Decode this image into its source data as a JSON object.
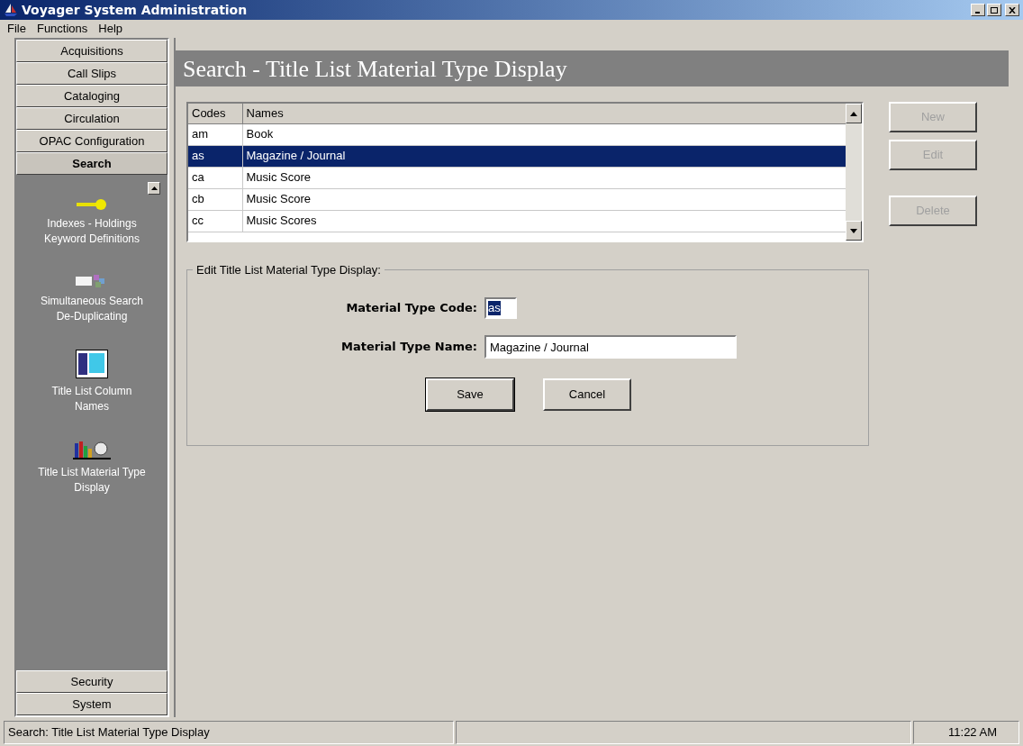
{
  "window": {
    "title": "Voyager System Administration"
  },
  "menu": [
    "File",
    "Functions",
    "Help"
  ],
  "sidebar": {
    "sections_top": [
      {
        "label": "Acquisitions",
        "expanded": false
      },
      {
        "label": "Call Slips",
        "expanded": false
      },
      {
        "label": "Cataloging",
        "expanded": false
      },
      {
        "label": "Circulation",
        "expanded": false
      },
      {
        "label": "OPAC Configuration",
        "expanded": false
      },
      {
        "label": "Search",
        "expanded": true
      }
    ],
    "items": [
      {
        "kind": "key",
        "label": "Indexes - Holdings Keyword Definitions"
      },
      {
        "kind": "dedup",
        "label": "Simultaneous Search De-Duplicating"
      },
      {
        "kind": "columns",
        "label": "Title List Column Names"
      },
      {
        "kind": "material",
        "label": "Title List Material Type Display"
      }
    ],
    "sections_bottom": [
      {
        "label": "Security",
        "expanded": false
      },
      {
        "label": "System",
        "expanded": false
      }
    ]
  },
  "header": "Search - Title List Material Type Display",
  "table": {
    "columns": [
      "Codes",
      "Names"
    ],
    "rows": [
      {
        "code": "am",
        "name": "Book",
        "selected": false
      },
      {
        "code": "as",
        "name": "Magazine / Journal",
        "selected": true
      },
      {
        "code": "ca",
        "name": "Music Score",
        "selected": false
      },
      {
        "code": "cb",
        "name": "Music Score",
        "selected": false
      },
      {
        "code": "cc",
        "name": "Music Scores",
        "selected": false
      }
    ]
  },
  "side_buttons": [
    {
      "label": "New",
      "disabled": true
    },
    {
      "label": "Edit",
      "disabled": true
    },
    {
      "label": "Delete",
      "disabled": true
    }
  ],
  "edit_group": {
    "title": "Edit Title List Material Type Display:",
    "code_label": "Material Type Code:",
    "code_value": "as",
    "name_label": "Material Type Name:",
    "name_value": "Magazine / Journal",
    "buttons": [
      {
        "label": "Save",
        "default": true
      },
      {
        "label": "Cancel",
        "default": false
      }
    ]
  },
  "status_bar": {
    "message": "Search:  Title List Material Type Display",
    "time": "11:22 AM"
  }
}
